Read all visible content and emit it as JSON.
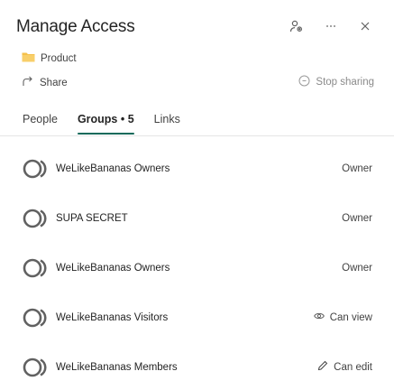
{
  "header": {
    "title": "Manage Access"
  },
  "item": {
    "folder_name": "Product",
    "share_label": "Share",
    "stop_sharing_label": "Stop sharing"
  },
  "tabs": [
    {
      "label": "People",
      "active": false
    },
    {
      "label": "Groups • 5",
      "active": true
    },
    {
      "label": "Links",
      "active": false
    }
  ],
  "groups": [
    {
      "name": "WeLikeBananas Owners",
      "role": "Owner",
      "role_icon": ""
    },
    {
      "name": "SUPA SECRET",
      "role": "Owner",
      "role_icon": ""
    },
    {
      "name": "WeLikeBananas Owners",
      "role": "Owner",
      "role_icon": ""
    },
    {
      "name": "WeLikeBananas Visitors",
      "role": "Can view",
      "role_icon": "eye-icon"
    },
    {
      "name": "WeLikeBananas Members",
      "role": "Can edit",
      "role_icon": "pencil-icon"
    }
  ],
  "colors": {
    "accent": "#116a5b",
    "folder": "#f5c04a",
    "avatar": "#616161"
  }
}
